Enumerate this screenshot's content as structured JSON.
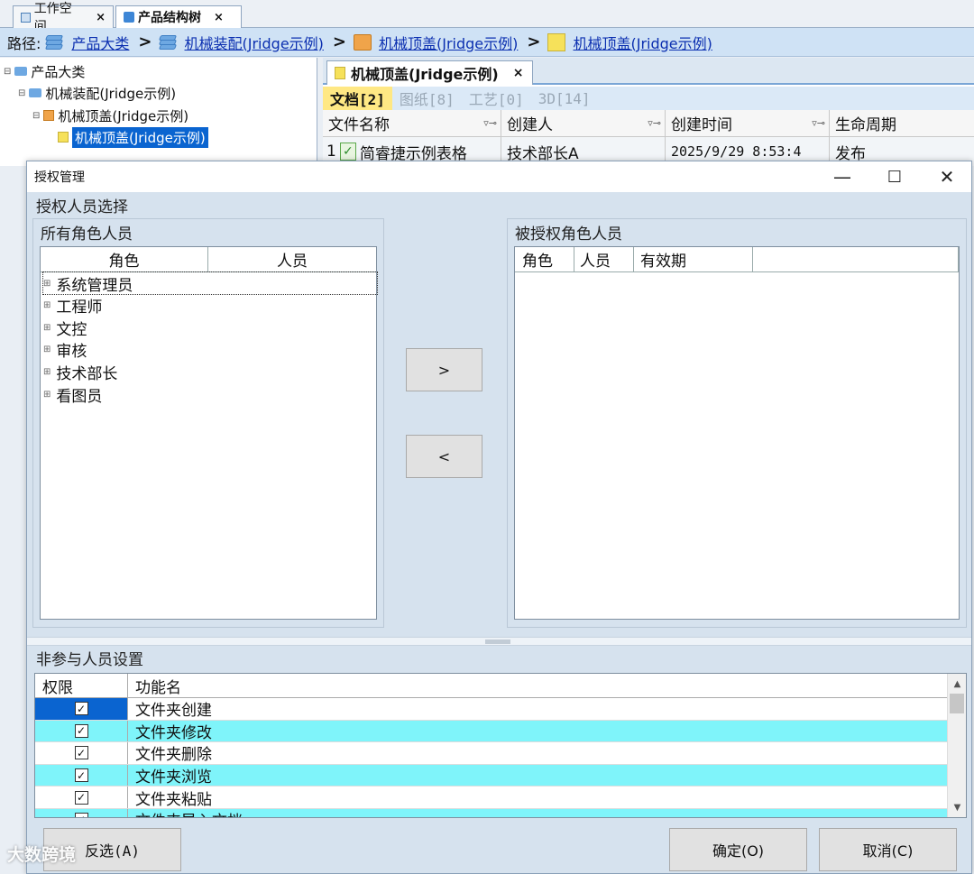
{
  "top_tabs": [
    {
      "label": "工作空间",
      "close": "×"
    },
    {
      "label": "产品结构树",
      "close": "×"
    }
  ],
  "breadcrumb": {
    "prefix": "路径:",
    "items": [
      "产品大类",
      "机械装配(Jridge示例)",
      "机械顶盖(Jridge示例)",
      "机械顶盖(Jridge示例)"
    ],
    "separator": ">"
  },
  "tree": {
    "nodes": [
      "产品大类",
      "机械装配(Jridge示例)",
      "机械顶盖(Jridge示例)",
      "机械顶盖(Jridge示例)"
    ]
  },
  "doc_panel": {
    "tab_label": "机械顶盖(Jridge示例)",
    "tab_close": "×",
    "sub_tabs": [
      "文档[2]",
      "图纸[8]",
      "工艺[0]",
      "3D[14]"
    ],
    "columns": [
      "文件名称",
      "创建人",
      "创建时间",
      "生命周期"
    ],
    "filter_glyph": "▿⊸",
    "row": {
      "index": "1",
      "name": "简睿捷示例表格",
      "creator": "技术部长A",
      "created": "2025/9/29 8:53:4",
      "lifecycle": "发布"
    }
  },
  "dialog": {
    "title": "授权管理",
    "window_buttons": {
      "minimize": "—",
      "maximize": "☐",
      "close": "✕"
    },
    "section_select": "授权人员选择",
    "left_group": {
      "title": "所有角色人员",
      "columns": [
        "角色",
        "人员"
      ],
      "roles": [
        "系统管理员",
        "工程师",
        "文控",
        "审核",
        "技术部长",
        "看图员"
      ],
      "expand_glyph": "⊞"
    },
    "right_group": {
      "title": "被授权角色人员",
      "columns": [
        "角色",
        "人员",
        "有效期"
      ]
    },
    "move_right_label": ">",
    "move_left_label": "<",
    "section_nonparticipant": "非参与人员设置",
    "perm_columns": [
      "权限",
      "功能名"
    ],
    "check_glyph": "✓",
    "permissions": [
      {
        "name": "文件夹创建",
        "checked": true
      },
      {
        "name": "文件夹修改",
        "checked": true
      },
      {
        "name": "文件夹删除",
        "checked": true
      },
      {
        "name": "文件夹浏览",
        "checked": true
      },
      {
        "name": "文件夹粘贴",
        "checked": true
      },
      {
        "name": "文件夹导入文档",
        "checked": true
      }
    ],
    "scroll_up": "▲",
    "scroll_down": "▼",
    "invert_button": "反选(A)",
    "ok_button": "确定(O)",
    "cancel_button": "取消(C)"
  },
  "watermark": "大数跨境"
}
